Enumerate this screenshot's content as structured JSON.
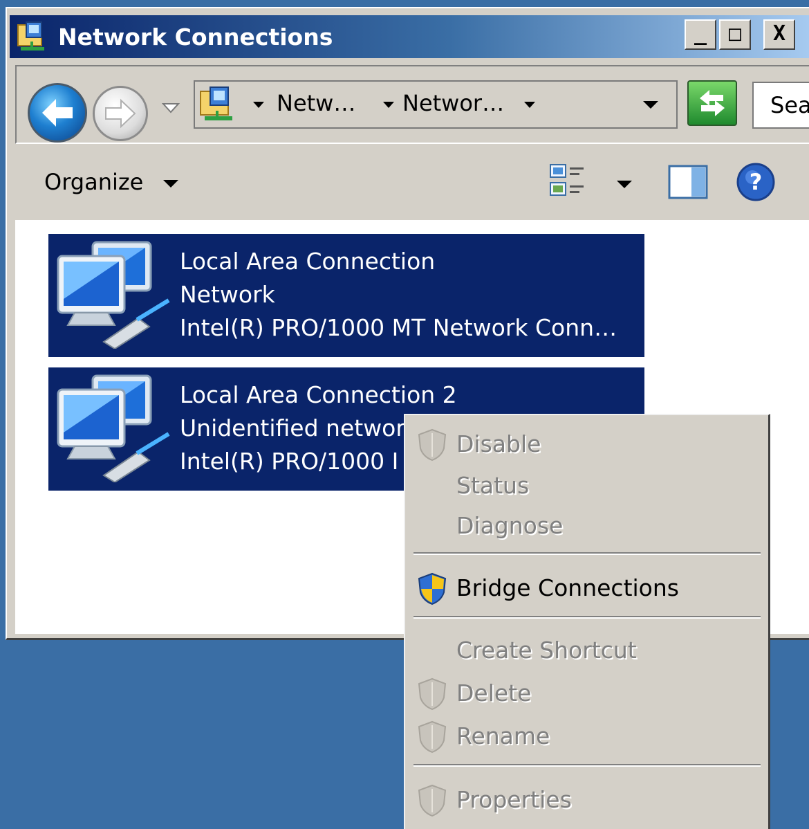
{
  "window": {
    "title": "Network Connections",
    "buttons": {
      "minimize": "_",
      "maximize": "□",
      "close": "X"
    }
  },
  "nav": {
    "breadcrumbs": [
      "Netw…",
      "Networ…"
    ],
    "search_placeholder": "Sea"
  },
  "toolbar": {
    "organize_label": "Organize"
  },
  "connections": [
    {
      "name": "Local Area Connection",
      "status": "Network",
      "device": "Intel(R) PRO/1000 MT Network Conn…"
    },
    {
      "name": "Local Area Connection 2",
      "status": "Unidentified networ",
      "device": "Intel(R) PRO/1000 I"
    }
  ],
  "context_menu": {
    "items": [
      {
        "label": "Disable",
        "enabled": false,
        "shield": true
      },
      {
        "label": "Status",
        "enabled": false,
        "shield": false
      },
      {
        "label": "Diagnose",
        "enabled": false,
        "shield": false
      },
      {
        "label": "Bridge Connections",
        "enabled": true,
        "shield": true
      },
      {
        "label": "Create Shortcut",
        "enabled": false,
        "shield": false
      },
      {
        "label": "Delete",
        "enabled": false,
        "shield": true
      },
      {
        "label": "Rename",
        "enabled": false,
        "shield": true
      },
      {
        "label": "Properties",
        "enabled": false,
        "shield": true
      }
    ]
  },
  "colors": {
    "desktop": "#3a6ea5",
    "selection": "#0a246a",
    "face": "#d4d0c8"
  }
}
